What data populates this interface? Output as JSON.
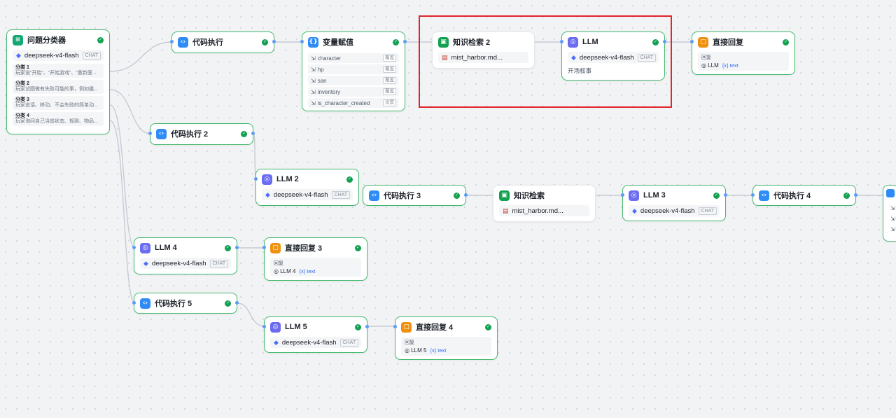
{
  "nodes": {
    "classifier": {
      "title": "问题分类器",
      "model": "deepseek-v4-flash",
      "mode": "CHAT",
      "categories": [
        {
          "label": "分类 1",
          "desc": "玩家说“开始”、“开始游戏”、“重新便..."
        },
        {
          "label": "分类 2",
          "desc": "玩家试图做有失败可能的事，例如撬..."
        },
        {
          "label": "分类 3",
          "desc": "玩家说话、移动、不会失败的简单动..."
        },
        {
          "label": "分类 4",
          "desc": "玩家询问自己当前状态、规则、物品..."
        }
      ]
    },
    "code1": {
      "title": "代码执行"
    },
    "varfilter": {
      "title": "变量赋值",
      "vars": [
        {
          "name": "character",
          "tag": "覆盖"
        },
        {
          "name": "hp",
          "tag": "覆盖"
        },
        {
          "name": "san",
          "tag": "覆盖"
        },
        {
          "name": "inventory",
          "tag": "覆盖"
        },
        {
          "name": "is_character_created",
          "tag": "设置"
        }
      ]
    },
    "kb2": {
      "title": "知识检索 2",
      "file": "mist_harbor.md..."
    },
    "llm1": {
      "title": "LLM",
      "model": "deepseek-v4-flash",
      "mode": "CHAT",
      "note": "开场叙事"
    },
    "reply1": {
      "title": "直接回复",
      "label": "回复",
      "ref": "LLM",
      "var": "{x} text"
    },
    "code2": {
      "title": "代码执行 2"
    },
    "llm2": {
      "title": "LLM 2",
      "model": "deepseek-v4-flash",
      "mode": "CHAT"
    },
    "code3": {
      "title": "代码执行 3"
    },
    "kb1": {
      "title": "知识检索",
      "file": "mist_harbor.md..."
    },
    "llm3": {
      "title": "LLM 3",
      "model": "deepseek-v4-flash",
      "mode": "CHAT"
    },
    "code4": {
      "title": "代码执行 4"
    },
    "llm4": {
      "title": "LLM 4",
      "model": "deepseek-v4-flash",
      "mode": "CHAT"
    },
    "reply3": {
      "title": "直接回复 3",
      "label": "回复",
      "ref": "LLM 4",
      "var": "{x} text"
    },
    "code5": {
      "title": "代码执行 5"
    },
    "llm5": {
      "title": "LLM 5",
      "model": "deepseek-v4-flash",
      "mode": "CHAT"
    },
    "reply4": {
      "title": "直接回复 4",
      "label": "回复",
      "ref": "LLM 5",
      "var": "{x} text"
    }
  },
  "colors": {
    "edge": "#c6cbd4",
    "success": "#12a150",
    "selection": "#e0262b",
    "node_border": "#43b96f"
  },
  "icons": {
    "code": "code-icon",
    "llm": "llm-icon",
    "knowledge": "knowledge-icon",
    "reply": "reply-icon",
    "classifier": "classifier-icon",
    "variable": "variable-icon"
  }
}
